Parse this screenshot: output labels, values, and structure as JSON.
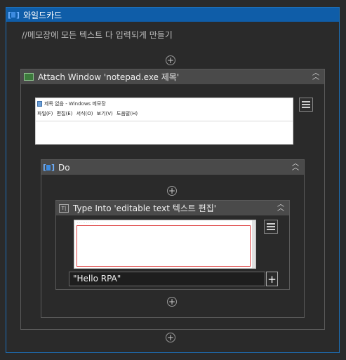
{
  "outer": {
    "title": "와일드카드",
    "comment": "//메모장에 모든 텍스트 다 입력되게 만들기"
  },
  "attach": {
    "title": "Attach Window 'notepad.exe 제목'",
    "screenshot": {
      "window_title": "제목 없음 - Windows 메모장",
      "menu": "파일(F) 편집(E) 서식(O) 보기(V) 도움말(H)"
    }
  },
  "do": {
    "title": "Do"
  },
  "type_into": {
    "title": "Type Into 'editable text  텍스트 편집'",
    "text_value": "\"Hello RPA\"",
    "add_label": "+"
  },
  "icons": {
    "sequence": "sequence-icon",
    "window": "window-icon",
    "type": "type-into-icon",
    "collapse": "chevron-double-up-icon",
    "menu": "hamburger-icon",
    "add": "plus-circle-icon"
  },
  "colors": {
    "accent": "#0f5da8",
    "border": "#1c6fb8",
    "panel": "#4a4a4a",
    "background": "#2a2a2a"
  }
}
